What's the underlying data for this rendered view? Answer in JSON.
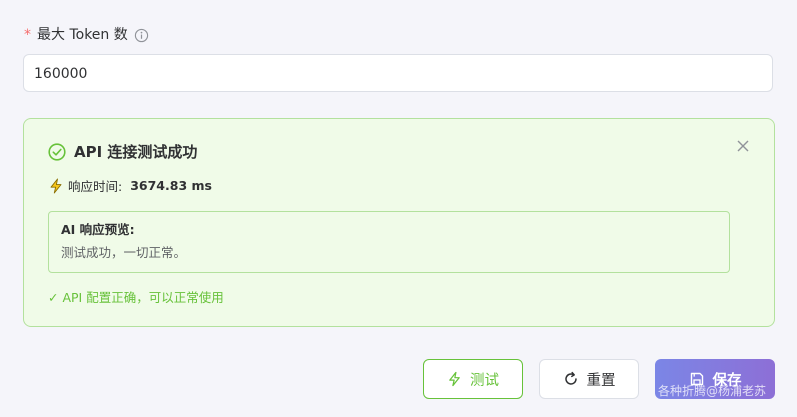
{
  "form": {
    "required_mark": "*",
    "max_tokens_label": "最大 Token 数",
    "max_tokens_value": "160000"
  },
  "result": {
    "title": "API 连接测试成功",
    "response_time_label": "响应时间:",
    "response_time_value": "3674.83 ms",
    "preview_title": "AI 响应预览:",
    "preview_text": "测试成功，一切正常。",
    "success_note": "✓ API 配置正确，可以正常使用"
  },
  "buttons": {
    "test": "测试",
    "reset": "重置",
    "save": "保存"
  },
  "watermark": "各种折腾@杨浦老苏",
  "colors": {
    "success": "#67c23a",
    "success_border": "#b3e19d",
    "success_bg": "#f0fbe8",
    "required": "#f56c6c",
    "save_gradient_start": "#7b86e6",
    "save_gradient_end": "#8d6fd6"
  },
  "icons": {
    "label_info": "info-circle-icon",
    "result_title": "check-circle-icon",
    "response_time": "lightning-icon",
    "close": "close-icon",
    "test_button": "lightning-icon",
    "reset_button": "refresh-icon",
    "save_button": "save-icon"
  }
}
